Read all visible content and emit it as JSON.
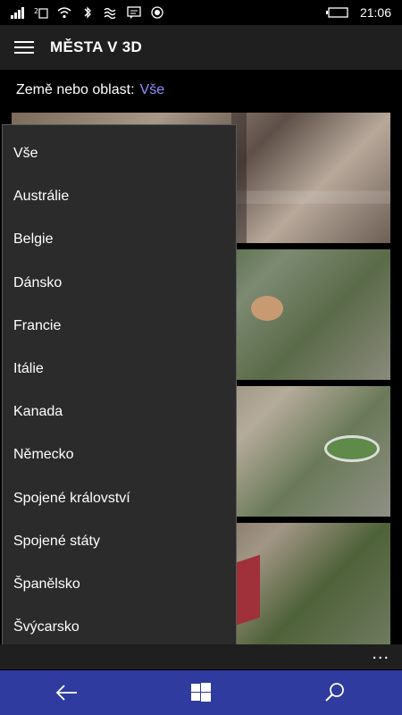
{
  "status_bar": {
    "time": "21:06",
    "icons": [
      "signal-icon",
      "sim-icon",
      "wifi-icon",
      "bluetooth-icon",
      "vibrate-icon",
      "message-icon",
      "record-icon",
      "battery-icon"
    ]
  },
  "header": {
    "title": "MĚSTA V 3D",
    "menu_icon": "hamburger-icon"
  },
  "filter": {
    "label": "Země nebo oblast:",
    "value": "Vše"
  },
  "dropdown": {
    "options": [
      "Vše",
      "Austrálie",
      "Belgie",
      "Dánsko",
      "Francie",
      "Itálie",
      "Kanada",
      "Německo",
      "Spojené království",
      "Spojené státy",
      "Španělsko",
      "Švýcarsko"
    ]
  },
  "app_bar": {
    "more_label": "..."
  },
  "nav_bar": {
    "buttons": [
      "back-icon",
      "windows-icon",
      "search-icon"
    ],
    "color": "#2f3b9e"
  }
}
